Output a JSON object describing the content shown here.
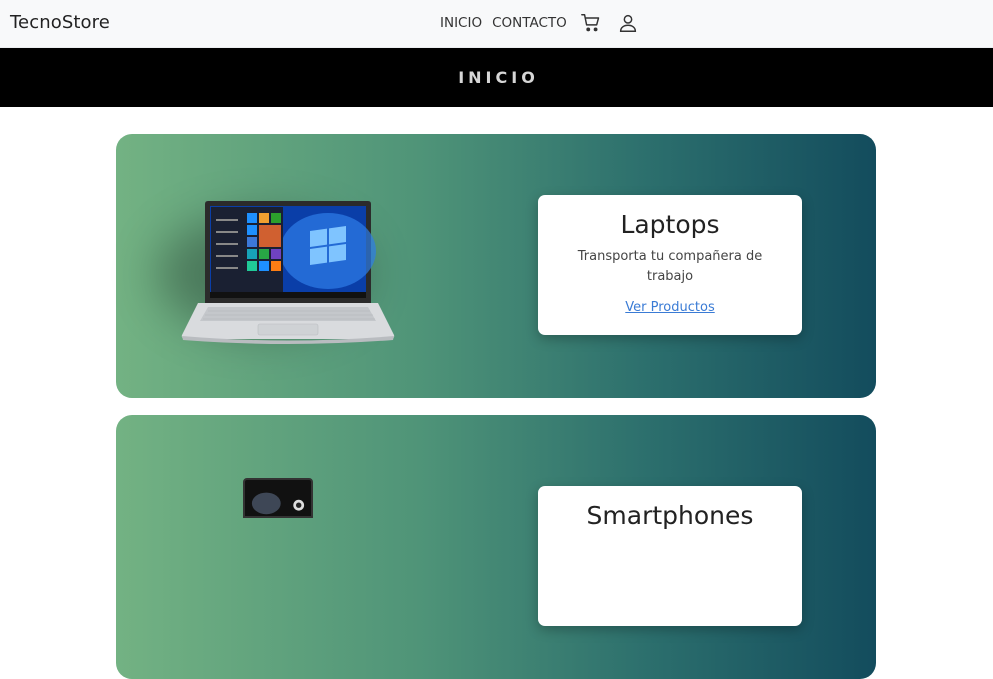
{
  "header": {
    "brand": "TecnoStore",
    "nav": {
      "home": "INICIO",
      "contact": "CONTACTO"
    },
    "icons": {
      "cart": "cart-icon",
      "user": "user-icon"
    }
  },
  "banner": {
    "title": "INICIO"
  },
  "categories": [
    {
      "title": "Laptops",
      "description": "Transporta tu compañera de trabajo",
      "link": "Ver Productos",
      "image": "laptop-image"
    },
    {
      "title": "Smartphones",
      "image": "phone-image"
    }
  ],
  "colors": {
    "gradient_start": "#73b283",
    "gradient_end": "#134c5d",
    "link": "#3a7bd5",
    "banner_bg": "#000000"
  }
}
